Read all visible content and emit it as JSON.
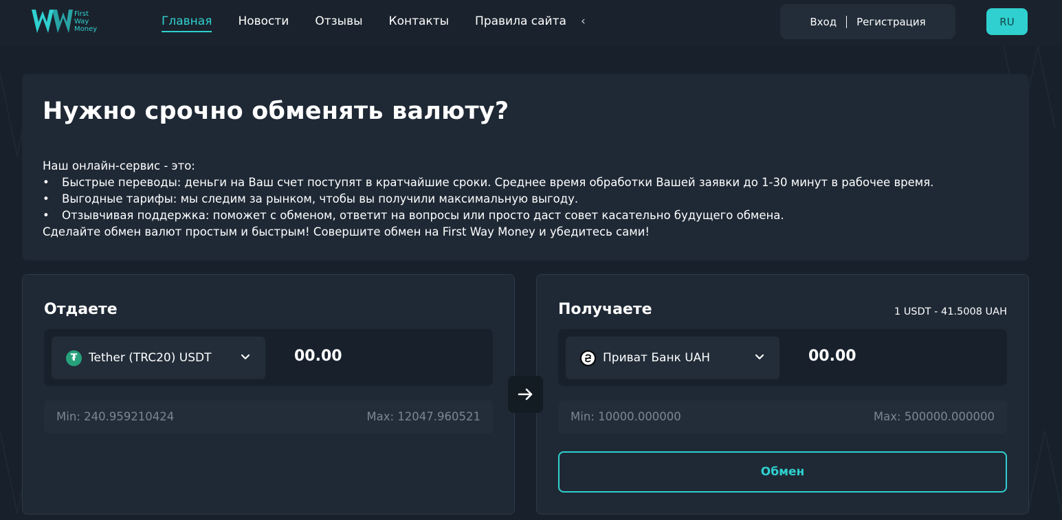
{
  "brand": {
    "logo_text_1": "First",
    "logo_text_2": "Way",
    "logo_text_3": "Money",
    "accent": "#2fd0cf"
  },
  "nav": {
    "items": [
      {
        "label": "Главная",
        "active": true
      },
      {
        "label": "Новости"
      },
      {
        "label": "Отзывы"
      },
      {
        "label": "Контакты"
      },
      {
        "label": "Правила сайта"
      }
    ],
    "more_icon": "chevron-left-icon"
  },
  "auth": {
    "login": "Вход",
    "register": "Регистрация"
  },
  "lang": "RU",
  "intro": {
    "title": "Нужно срочно обменять валюту?",
    "lead": "Наш онлайн-сервис - это:",
    "bullets": [
      "Быстрые переводы: деньги на Ваш счет поступят в кратчайшие сроки. Среднее время обработки Вашей заявки до 1-30 минут в рабочее время.",
      "Выгодные тарифы: мы следим за рынком, чтобы вы получили максимальную выгоду.",
      "Отзывчивая поддержка: поможет с обменом, ответит на вопросы или просто даст совет касательно будущего обмена."
    ],
    "outro": "Сделайте обмен валют простым и быстрым! Совершите обмен на First Way Money и убедитесь сами!"
  },
  "give": {
    "title": "Отдаете",
    "currency": "Tether (TRC20) USDT",
    "currency_icon": "tether-icon",
    "amount": "00.00",
    "min": "Min: 240.959210424",
    "max": "Max: 12047.960521"
  },
  "receive": {
    "title": "Получаете",
    "rate": "1 USDT - 41.5008 UAH",
    "currency": "Приват Банк UAH",
    "currency_icon": "privatbank-icon",
    "amount": "00.00",
    "min": "Min: 10000.000000",
    "max": "Max: 500000.000000",
    "submit": "Обмен"
  }
}
